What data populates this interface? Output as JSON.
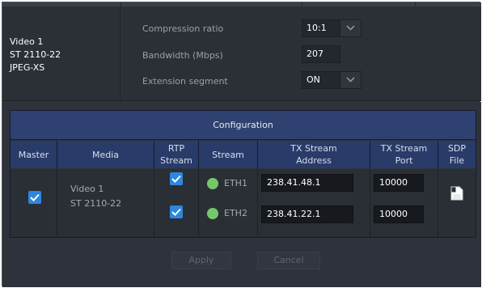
{
  "source": {
    "name": "Video 1",
    "standard": "ST 2110-22",
    "codec": "JPEG-XS"
  },
  "settings": {
    "compression_label": "Compression ratio",
    "compression_value": "10:1",
    "bandwidth_label": "Bandwidth (Mbps)",
    "bandwidth_value": "207",
    "extension_label": "Extension segment",
    "extension_value": "ON"
  },
  "table": {
    "title": "Configuration",
    "headers": {
      "master": "Master",
      "media": "Media",
      "rtp_line1": "RTP",
      "rtp_line2": "Stream",
      "stream": "Stream",
      "tx_addr_line1": "TX Stream",
      "tx_addr_line2": "Address",
      "tx_port_line1": "TX Stream",
      "tx_port_line2": "Port",
      "sdp_line1": "SDP",
      "sdp_line2": "File"
    },
    "row": {
      "master_checked": true,
      "media_name": "Video 1",
      "media_standard": "ST 2110-22",
      "streams": [
        {
          "rtp_checked": true,
          "status_color": "#76c66a",
          "interface": "ETH1",
          "address": "238.41.48.1",
          "port": "10000"
        },
        {
          "rtp_checked": true,
          "status_color": "#76c66a",
          "interface": "ETH2",
          "address": "238.41.22.1",
          "port": "10000"
        }
      ],
      "sdp_icon": "file-icon"
    }
  },
  "buttons": {
    "apply": "Apply",
    "cancel": "Cancel"
  }
}
